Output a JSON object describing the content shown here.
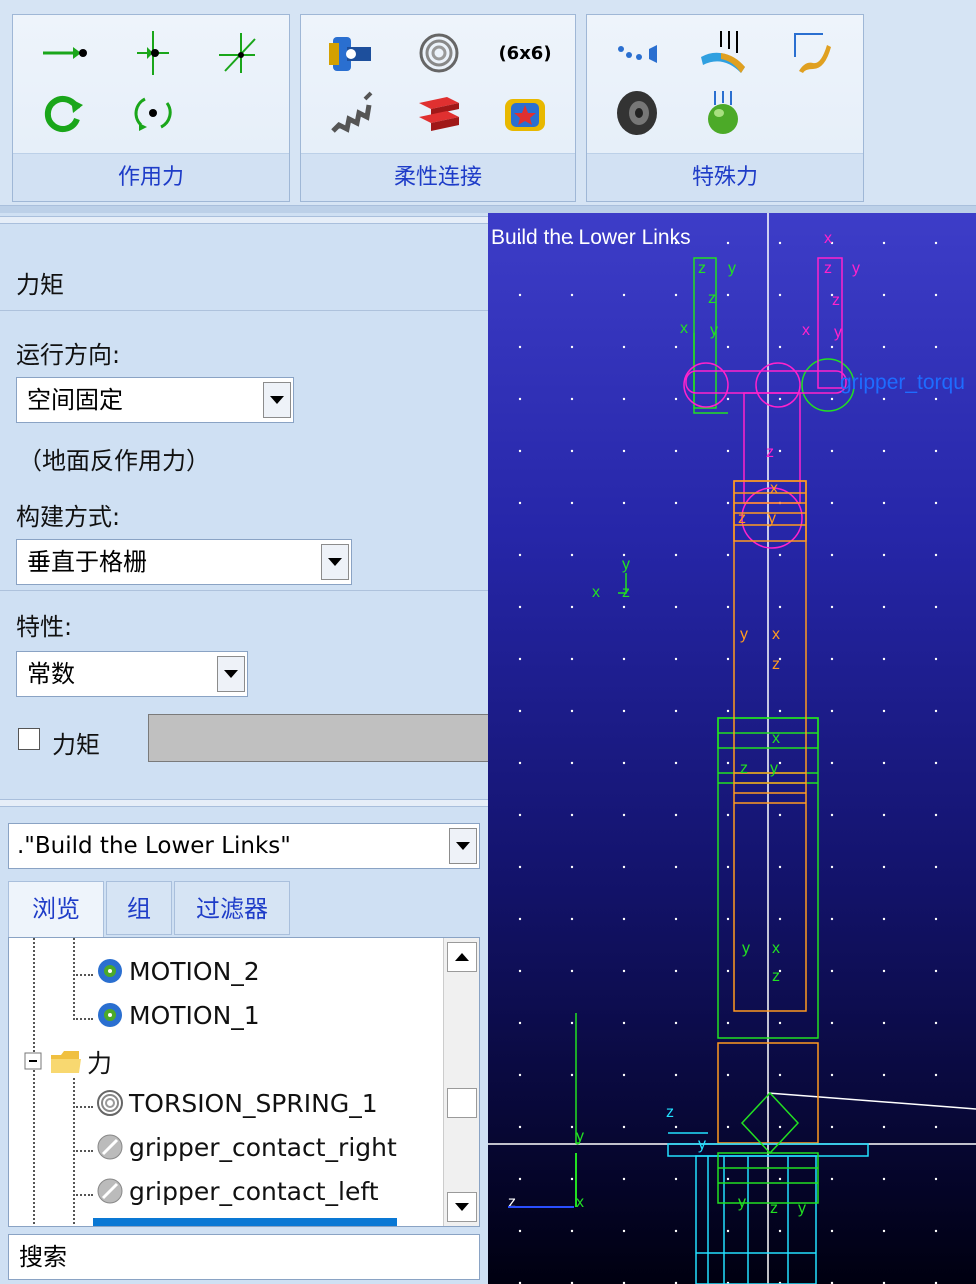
{
  "ribbon": {
    "groups": [
      {
        "label": "作用力",
        "tools": [
          "single-force-icon",
          "single-force-3pt-icon",
          "general-force-icon",
          "single-torque-icon",
          "torque-3pt-icon"
        ]
      },
      {
        "label": "柔性连接",
        "tools": [
          "bushing-icon",
          "torsion-spring-icon",
          "matrix-6x6-icon",
          "translational-spring-icon",
          "beam-icon",
          "field-icon"
        ]
      },
      {
        "label": "特殊力",
        "tools": [
          "modal-force-icon",
          "multi-point-force-icon",
          "gravity-force-icon",
          "tire-icon",
          "contact-icon"
        ]
      }
    ],
    "matrix_label": "(6x6)"
  },
  "panel": {
    "title": "力矩",
    "direction_label": "运行方向:",
    "direction_value": "空间固定",
    "direction_note": "（地面反作用力）",
    "construction_label": "构建方式:",
    "construction_value": "垂直于格栅",
    "property_label": "特性:",
    "property_value": "常数",
    "torque_checkbox_label": "力矩"
  },
  "browser": {
    "model": ".\"Build the Lower Links\"",
    "tabs": [
      "浏览",
      "组",
      "过滤器"
    ],
    "items": [
      {
        "label": "MOTION_2",
        "icon": "motion-icon"
      },
      {
        "label": "MOTION_1",
        "icon": "motion-icon"
      },
      {
        "label": "力",
        "icon": "folder-icon"
      },
      {
        "label": "TORSION_SPRING_1",
        "icon": "torsion-spring-icon"
      },
      {
        "label": "gripper_contact_right",
        "icon": "contact-icon"
      },
      {
        "label": "gripper_contact_left",
        "icon": "contact-icon"
      }
    ],
    "search_placeholder": "搜索"
  },
  "viewport": {
    "title": "Build the Lower Links",
    "label_gripper": "gripper_torqu",
    "colors": {
      "green": "#22e022",
      "magenta": "#ff22cc",
      "orange": "#ff9a20",
      "cyan": "#22e0ff",
      "grid_dot": "#ffffff"
    }
  }
}
